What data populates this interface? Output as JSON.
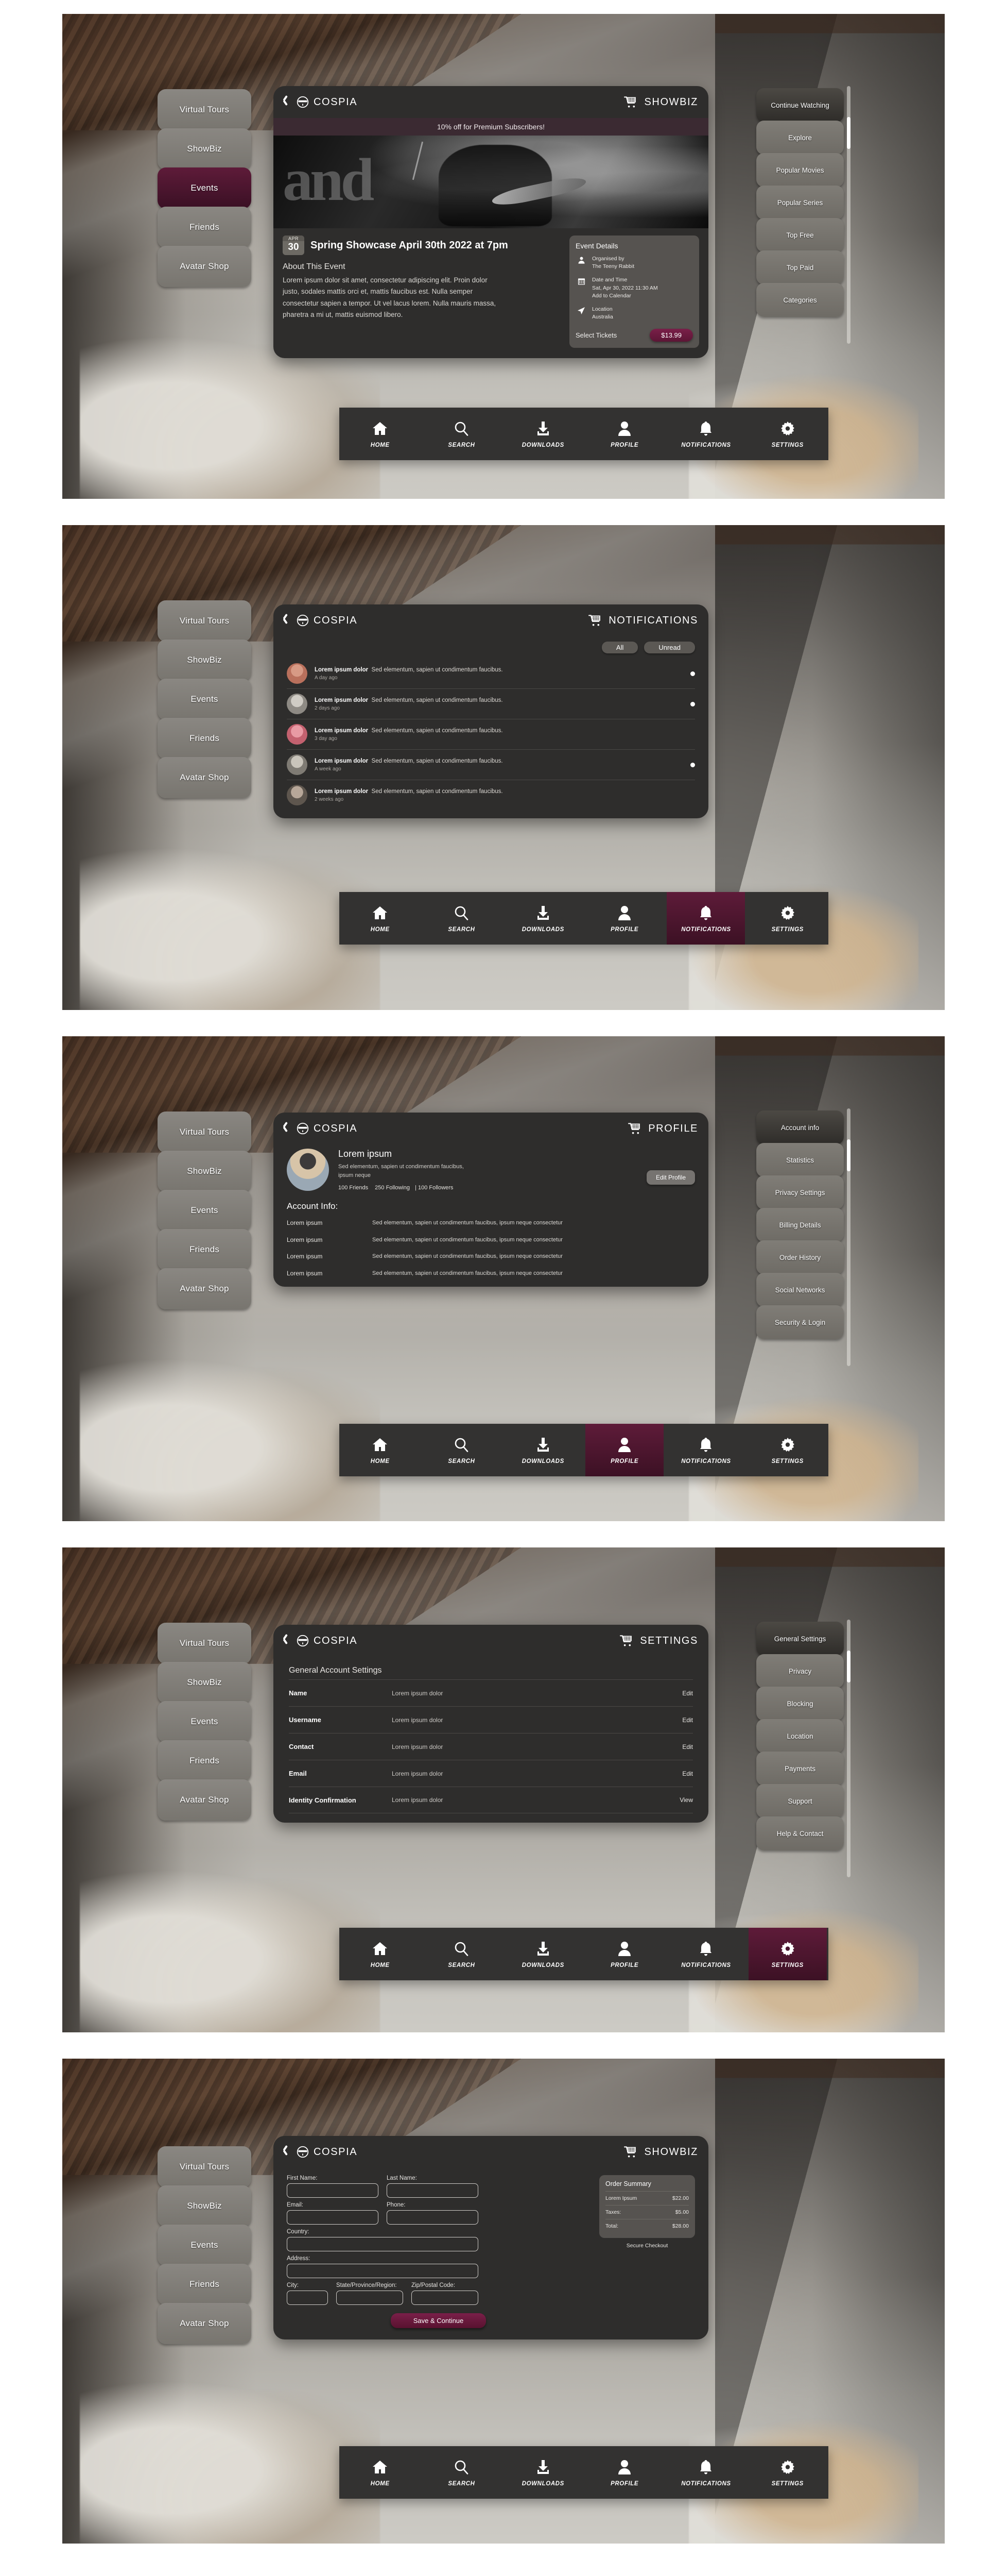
{
  "brand": {
    "name": "COSPIA",
    "logo_icon": "cospia-mask-icon",
    "back_icon": "back-chevron-icon",
    "cart_icon": "shopping-cart-icon"
  },
  "colors": {
    "accent": "#5e1b39",
    "panel_bg": "#2e2d2c",
    "rail_bg": "#7d7a74",
    "promo_bg": "#3b2a32"
  },
  "left_rail": {
    "items": [
      {
        "label": "Virtual Tours",
        "active": false
      },
      {
        "label": "ShowBiz",
        "active": false
      },
      {
        "label": "Events",
        "active": true
      },
      {
        "label": "Friends",
        "active": false
      },
      {
        "label": "Avatar Shop",
        "active": false
      }
    ],
    "items_inactive": [
      {
        "label": "Virtual Tours",
        "active": false
      },
      {
        "label": "ShowBiz",
        "active": false
      },
      {
        "label": "Events",
        "active": false
      },
      {
        "label": "Friends",
        "active": false
      },
      {
        "label": "Avatar Shop",
        "active": false
      }
    ]
  },
  "bottom_nav": {
    "items": [
      {
        "label": "HOME",
        "icon": "home-icon"
      },
      {
        "label": "SEARCH",
        "icon": "search-icon"
      },
      {
        "label": "DOWNLOADS",
        "icon": "download-icon"
      },
      {
        "label": "PROFILE",
        "icon": "person-icon"
      },
      {
        "label": "NOTIFICATIONS",
        "icon": "bell-icon"
      },
      {
        "label": "SETTINGS",
        "icon": "gear-icon"
      }
    ]
  },
  "screen1": {
    "header_title": "SHOWBIZ",
    "promo": "10% off for Premium Subscribers!",
    "hero_overlay_text": "and",
    "date_month": "APR",
    "date_day": "30",
    "event_title": "Spring Showcase April 30th 2022 at 7pm",
    "about_heading": "About This Event",
    "about_body": "Lorem ipsum dolor sit amet, consectetur adipiscing elit. Proin dolor justo, sodales mattis orci et, mattis faucibus est. Nulla semper consectetur sapien a tempor. Ut vel lacus lorem. Nulla mauris massa, pharetra a mi ut, mattis euismod libero.",
    "details": {
      "heading": "Event Details",
      "organiser_label": "Organised by",
      "organiser_value": "The Teeny Rabbit",
      "datetime_label": "Date and Time",
      "datetime_value": "Sat, Apr 30, 2022 11:30 AM",
      "datetime_action": "Add to Calendar",
      "location_label": "Location",
      "location_value": "Australia",
      "tickets_label": "Select Tickets",
      "price": "$13.99"
    },
    "right_rail": [
      {
        "label": "Continue Watching",
        "active": true
      },
      {
        "label": "Explore",
        "active": false
      },
      {
        "label": "Popular Movies",
        "active": false
      },
      {
        "label": "Popular Series",
        "active": false
      },
      {
        "label": "Top Free",
        "active": false
      },
      {
        "label": "Top Paid",
        "active": false
      },
      {
        "label": "Categories",
        "active": false
      }
    ]
  },
  "screen2": {
    "header_title": "NOTIFICATIONS",
    "filters": [
      {
        "label": "All"
      },
      {
        "label": "Unread"
      }
    ],
    "notifications": [
      {
        "title": "Lorem ipsum dolor",
        "text": "Sed elementum, sapien ut condimentum faucibus.",
        "time": "A day ago",
        "unread": true
      },
      {
        "title": "Lorem ipsum dolor",
        "text": "Sed elementum, sapien ut condimentum faucibus.",
        "time": "2 days ago",
        "unread": true
      },
      {
        "title": "Lorem ipsum dolor",
        "text": "Sed elementum, sapien ut condimentum faucibus.",
        "time": "3 day ago",
        "unread": false
      },
      {
        "title": "Lorem ipsum dolor",
        "text": "Sed elementum, sapien ut condimentum faucibus.",
        "time": "A week ago",
        "unread": true
      },
      {
        "title": "Lorem ipsum dolor",
        "text": "Sed elementum, sapien ut condimentum faucibus.",
        "time": "2 weeks ago",
        "unread": false
      }
    ]
  },
  "screen3": {
    "header_title": "PROFILE",
    "user_name": "Lorem ipsum",
    "user_desc": "Sed elementum, sapien ut condimentum faucibus, ipsum neque",
    "stat_friends": "100 Friends",
    "stat_following": "250 Following",
    "stat_followers": "100 Followers",
    "edit_label": "Edit Profile",
    "account_heading": "Account Info:",
    "account_rows": [
      {
        "key": "Lorem ipsum",
        "value": "Sed elementum, sapien ut condimentum faucibus, ipsum neque consectetur"
      },
      {
        "key": "Lorem ipsum",
        "value": "Sed elementum, sapien ut condimentum faucibus, ipsum neque consectetur"
      },
      {
        "key": "Lorem ipsum",
        "value": "Sed elementum, sapien ut condimentum faucibus, ipsum neque consectetur"
      },
      {
        "key": "Lorem ipsum",
        "value": "Sed elementum, sapien ut condimentum faucibus, ipsum neque consectetur"
      }
    ],
    "right_rail": [
      {
        "label": "Account info",
        "active": true
      },
      {
        "label": "Statistics",
        "active": false
      },
      {
        "label": "Privacy Settings",
        "active": false
      },
      {
        "label": "Billing Details",
        "active": false
      },
      {
        "label": "Order History",
        "active": false
      },
      {
        "label": "Social Networks",
        "active": false
      },
      {
        "label": "Security & Login",
        "active": false
      }
    ]
  },
  "screen4": {
    "header_title": "SETTINGS",
    "section_heading": "General Account Settings",
    "rows": [
      {
        "key": "Name",
        "value": "Lorem ipsum dolor",
        "action": "Edit"
      },
      {
        "key": "Username",
        "value": "Lorem ipsum dolor",
        "action": "Edit"
      },
      {
        "key": "Contact",
        "value": "Lorem ipsum dolor",
        "action": "Edit"
      },
      {
        "key": "Email",
        "value": "Lorem ipsum dolor",
        "action": "Edit"
      },
      {
        "key": "Identity Confirmation",
        "value": "Lorem ipsum dolor",
        "action": "View"
      }
    ],
    "right_rail": [
      {
        "label": "General Settings",
        "active": true
      },
      {
        "label": "Privacy",
        "active": false
      },
      {
        "label": "Blocking",
        "active": false
      },
      {
        "label": "Location",
        "active": false
      },
      {
        "label": "Payments",
        "active": false
      },
      {
        "label": "Support",
        "active": false
      },
      {
        "label": "Help & Contact",
        "active": false
      }
    ]
  },
  "screen5": {
    "header_title": "SHOWBIZ",
    "fields": {
      "first_name_label": "First Name:",
      "first_name_value": "",
      "last_name_label": "Last Name:",
      "last_name_value": "",
      "email_label": "Email:",
      "email_value": "",
      "phone_label": "Phone:",
      "phone_value": "",
      "country_label": "Country:",
      "country_value": "",
      "address_label": "Address:",
      "address_value": "",
      "city_label": "City:",
      "city_value": "",
      "state_label": "State/Province/Region:",
      "state_value": "",
      "zip_label": "Zip/Postal Code:",
      "zip_value": ""
    },
    "save_label": "Save & Continue",
    "summary": {
      "heading": "Order Summary",
      "item_label": "Lorem Ipsum",
      "item_value": "$22.00",
      "taxes_label": "Taxes:",
      "taxes_value": "$5.00",
      "total_label": "Total:",
      "total_value": "$28.00",
      "secure_label": "Secure Checkout"
    }
  }
}
